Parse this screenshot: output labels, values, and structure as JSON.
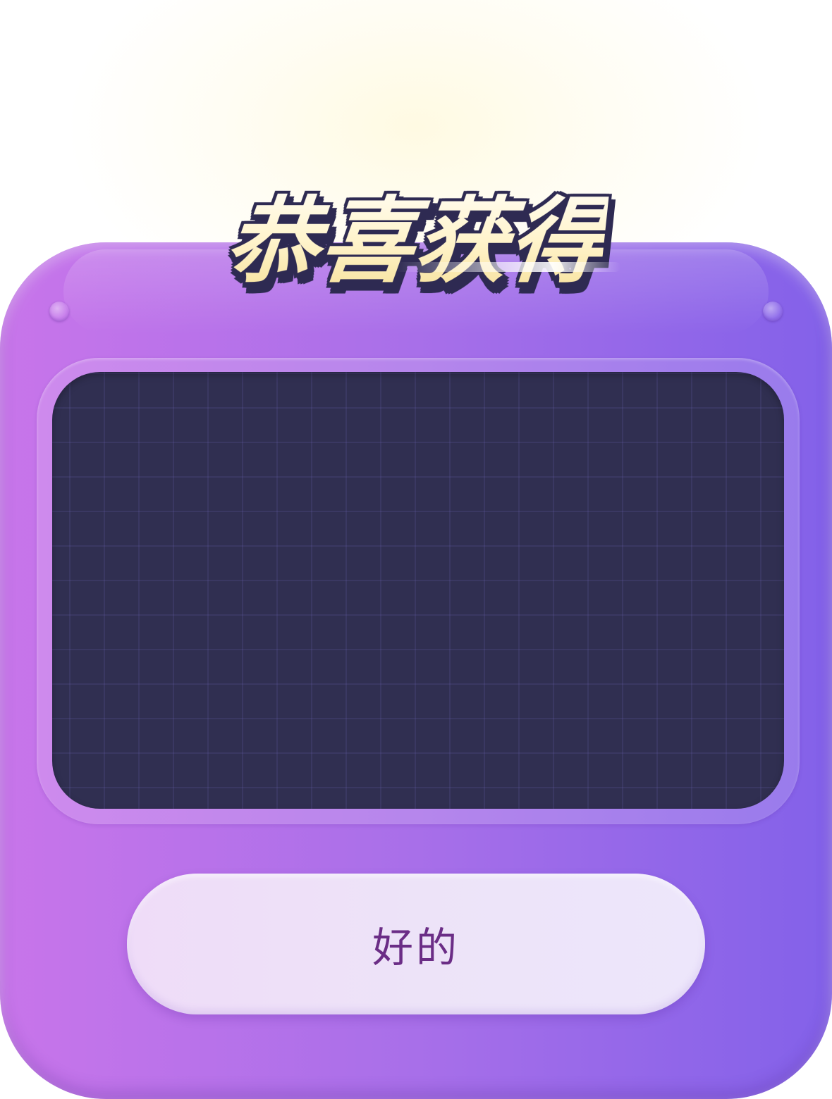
{
  "dialog": {
    "title": "恭喜获得",
    "confirm_label": "好的"
  },
  "colors": {
    "card_gradient_start": "#c875ea",
    "card_gradient_end": "#8361e9",
    "screen_background": "#302f51",
    "button_background": "#ede3f8",
    "button_text": "#6b2d86",
    "title_fill": "#fff4cc",
    "title_outline": "#2e2a52"
  }
}
